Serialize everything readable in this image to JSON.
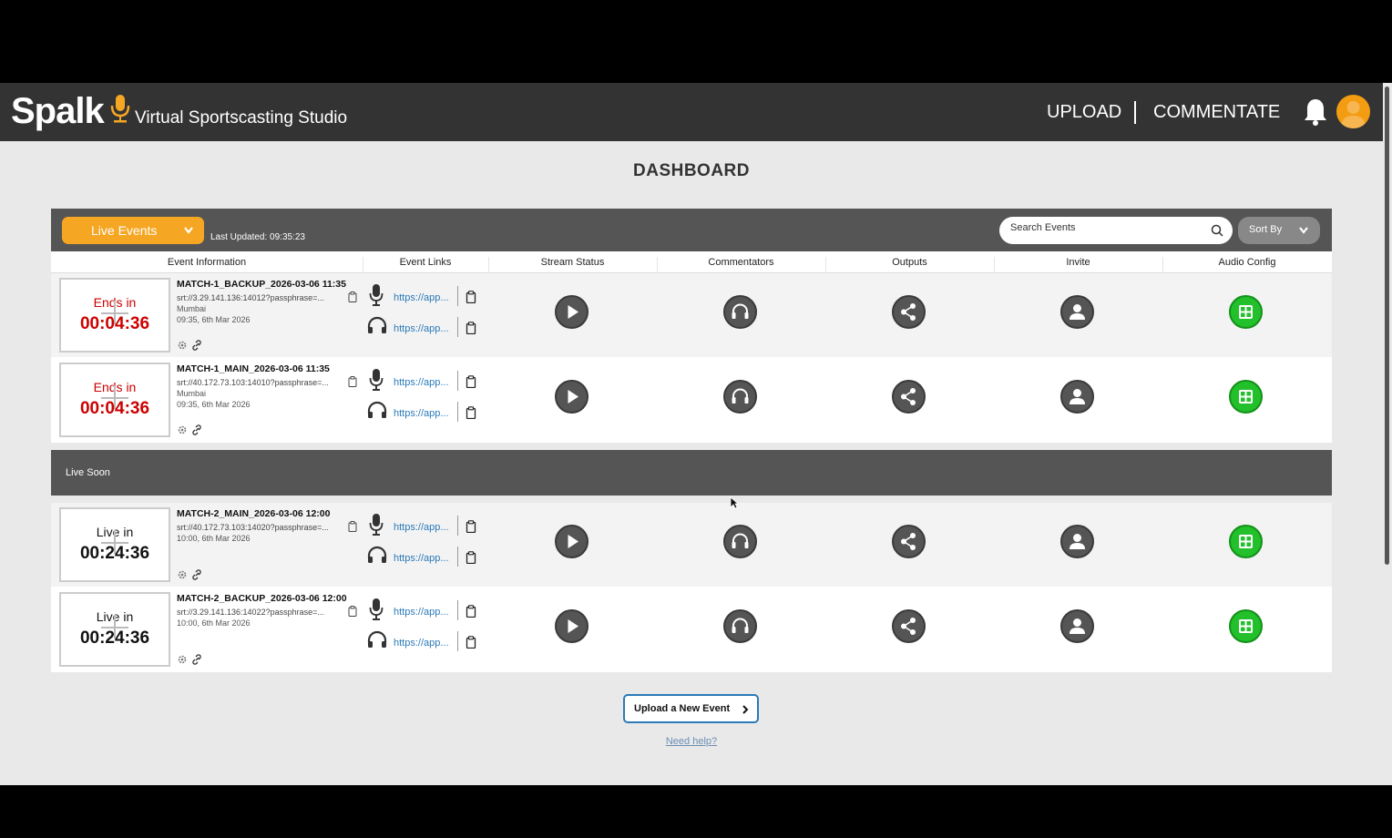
{
  "app": {
    "logo": "Spalk",
    "tagline": "Virtual Sportscasting Studio"
  },
  "nav": {
    "upload": "UPLOAD",
    "commentate": "COMMENTATE"
  },
  "page_title": "DASHBOARD",
  "toolbar": {
    "live_events": "Live Events",
    "last_updated": "Last Updated: 09:35:23",
    "search_placeholder": "Search Events",
    "sort_by": "Sort By"
  },
  "columns": [
    "Event Information",
    "Event Links",
    "Stream Status",
    "Commentators",
    "Outputs",
    "Invite",
    "Audio Config"
  ],
  "live_events": [
    {
      "timer_label": "Ends in",
      "timer_value": "00:04:36",
      "name": "MATCH-1_BACKUP_2026-03-06 11:35",
      "url": "srt://3.29.141.136:14012?passphrase=...",
      "location": "Mumbai",
      "date": "09:35, 6th Mar 2026",
      "link1": "https://app...",
      "link2": "https://app..."
    },
    {
      "timer_label": "Ends in",
      "timer_value": "00:04:36",
      "name": "MATCH-1_MAIN_2026-03-06 11:35",
      "url": "srt://40.172.73.103:14010?passphrase=...",
      "location": "Mumbai",
      "date": "09:35, 6th Mar 2026",
      "link1": "https://app...",
      "link2": "https://app..."
    }
  ],
  "live_soon_label": "Live Soon",
  "soon_events": [
    {
      "timer_label": "Live in",
      "timer_value": "00:24:36",
      "name": "MATCH-2_MAIN_2026-03-06 12:00",
      "url": "srt://40.172.73.103:14020?passphrase=...",
      "date": "10:00, 6th Mar 2026",
      "link1": "https://app...",
      "link2": "https://app..."
    },
    {
      "timer_label": "Live in",
      "timer_value": "00:24:36",
      "name": "MATCH-2_BACKUP_2026-03-06 12:00",
      "url": "srt://3.29.141.136:14022?passphrase=...",
      "date": "10:00, 6th Mar 2026",
      "link1": "https://app...",
      "link2": "https://app..."
    }
  ],
  "upload_new_event": "Upload a New Event",
  "need_help": "Need help?",
  "colors": {
    "accent": "#f5a623",
    "header": "#333333",
    "panel": "#555555",
    "green": "#22c02a",
    "link": "#2a7ab8",
    "timer_red": "#cc0000"
  },
  "icons": [
    "mic-icon",
    "bell-icon",
    "user-icon",
    "search-icon",
    "chevron-down-icon",
    "headphones-icon",
    "clipboard-icon",
    "play-icon",
    "share-icon",
    "grid-icon",
    "link-icon",
    "settings-icon",
    "chevron-right-icon"
  ]
}
